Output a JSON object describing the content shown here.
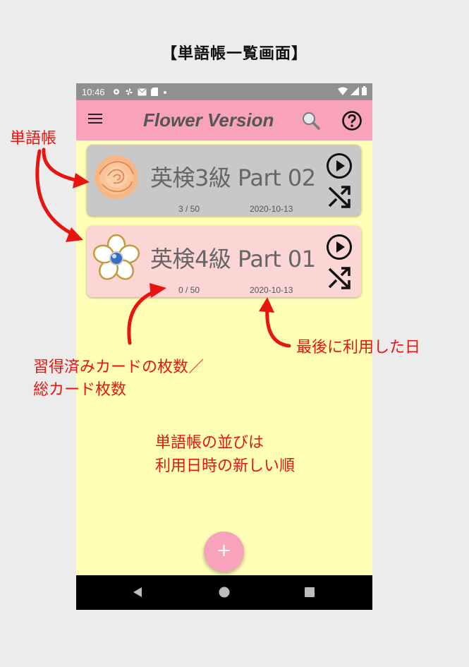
{
  "page_heading": "【単語帳一覧画面】",
  "status_bar": {
    "time": "10:46"
  },
  "app_bar": {
    "title": "Flower Version"
  },
  "cards": [
    {
      "title": "英検3級 Part 02",
      "count": "3 / 50",
      "date": "2020-10-13",
      "background": "#c8c8c8",
      "flower": "orange-rose-icon"
    },
    {
      "title": "英検4級 Part 01",
      "count": "0 / 50",
      "date": "2020-10-13",
      "background": "#fcd5d5",
      "flower": "white-flower-icon"
    }
  ],
  "fab": {
    "label": "+"
  },
  "annotations": {
    "wordbook": "単語帳",
    "learned_count_line1": "習得済みカードの枚数／",
    "learned_count_line2": "総カード枚数",
    "last_used": "最後に利用した日",
    "order_line1": "単語帳の並びは",
    "order_line2": "利用日時の新しい順"
  },
  "colors": {
    "accent": "#f8a3bb",
    "background": "#ffffb7",
    "annotation": "#e8140f"
  }
}
